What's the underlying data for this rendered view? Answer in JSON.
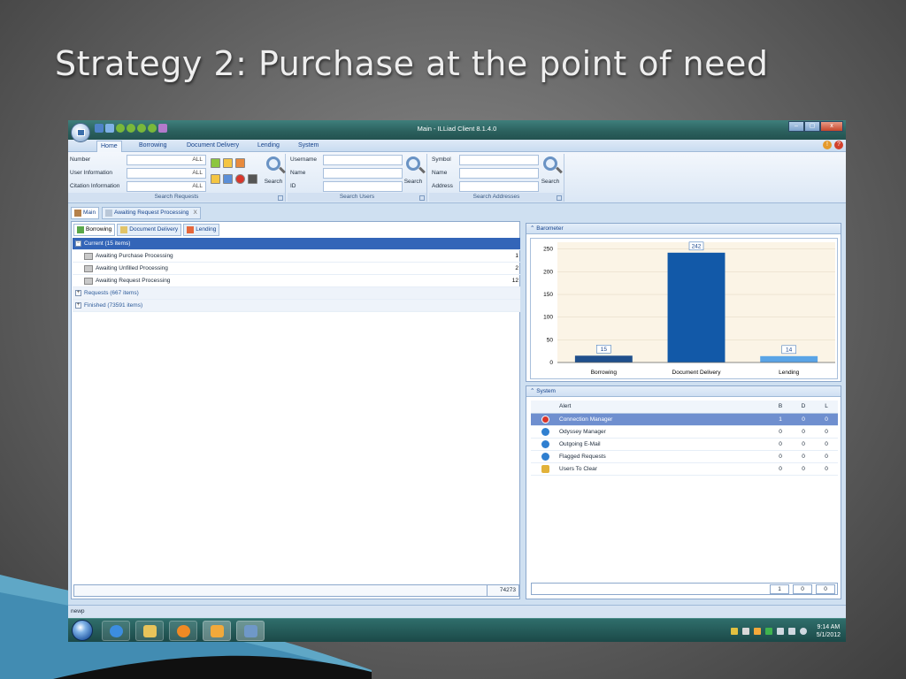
{
  "slide": {
    "title": "Strategy 2: Purchase at the point of need"
  },
  "window": {
    "title": "Main - ILLiad Client 8.1.4.0",
    "min": "–",
    "max": "▢",
    "close": "x"
  },
  "ribbon_tabs": [
    "Home",
    "Borrowing",
    "Document Delivery",
    "Lending",
    "System"
  ],
  "search_requests": {
    "fields": [
      {
        "label": "Number",
        "value": "ALL"
      },
      {
        "label": "User Information",
        "value": "ALL"
      },
      {
        "label": "Citation Information",
        "value": "ALL"
      }
    ],
    "button": "Search",
    "caption": "Search Requests"
  },
  "search_users": {
    "fields": [
      {
        "label": "Username"
      },
      {
        "label": "Name"
      },
      {
        "label": "ID"
      }
    ],
    "button": "Search",
    "caption": "Search Users"
  },
  "search_addresses": {
    "fields": [
      {
        "label": "Symbol"
      },
      {
        "label": "Name"
      },
      {
        "label": "Address"
      }
    ],
    "button": "Search",
    "caption": "Search Addresses"
  },
  "doc_tabs": [
    "Main",
    "Awaiting Request Processing"
  ],
  "doc_tab_close": "X",
  "sub_tabs": [
    "Borrowing",
    "Document Delivery",
    "Lending"
  ],
  "tree": {
    "current_group": "Current  (15 items)",
    "current_items": [
      {
        "label": "Awaiting Purchase Processing",
        "count": "1"
      },
      {
        "label": "Awaiting Unfilled Processing",
        "count": "2"
      },
      {
        "label": "Awaiting Request Processing",
        "count": "12"
      }
    ],
    "requests_group": "Requests  (667 items)",
    "finished_group": "Finished  (73591 items)"
  },
  "left_total": "74273",
  "barometer": {
    "title": "Barometer",
    "bar_colors": [
      "#1f4f8c",
      "#1259a8",
      "#5aa4e6"
    ]
  },
  "chart_data": {
    "type": "bar",
    "categories": [
      "Borrowing",
      "Document Delivery",
      "Lending"
    ],
    "values": [
      15,
      242,
      14
    ],
    "yticks": [
      0,
      50,
      100,
      150,
      200,
      250
    ],
    "ylim": [
      0,
      265
    ],
    "title": "",
    "xlabel": "",
    "ylabel": ""
  },
  "system": {
    "title": "System",
    "headers": {
      "alert": "Alert",
      "b": "B",
      "d": "D",
      "l": "L"
    },
    "rows": [
      {
        "icon": "error-icon",
        "alert": "Connection Manager",
        "b": "1",
        "d": "0",
        "l": "0"
      },
      {
        "icon": "info-icon",
        "alert": "Odyssey Manager",
        "b": "0",
        "d": "0",
        "l": "0"
      },
      {
        "icon": "info-icon",
        "alert": "Outgoing E-Mail",
        "b": "0",
        "d": "0",
        "l": "0"
      },
      {
        "icon": "info-icon",
        "alert": "Flagged Requests",
        "b": "0",
        "d": "0",
        "l": "0"
      },
      {
        "icon": "users-icon",
        "alert": "Users To Clear",
        "b": "0",
        "d": "0",
        "l": "0"
      }
    ],
    "totals": {
      "b": "1",
      "d": "0",
      "l": "0"
    }
  },
  "status_text": "newp",
  "clock": {
    "time": "9:14 AM",
    "date": "5/1/2012"
  }
}
